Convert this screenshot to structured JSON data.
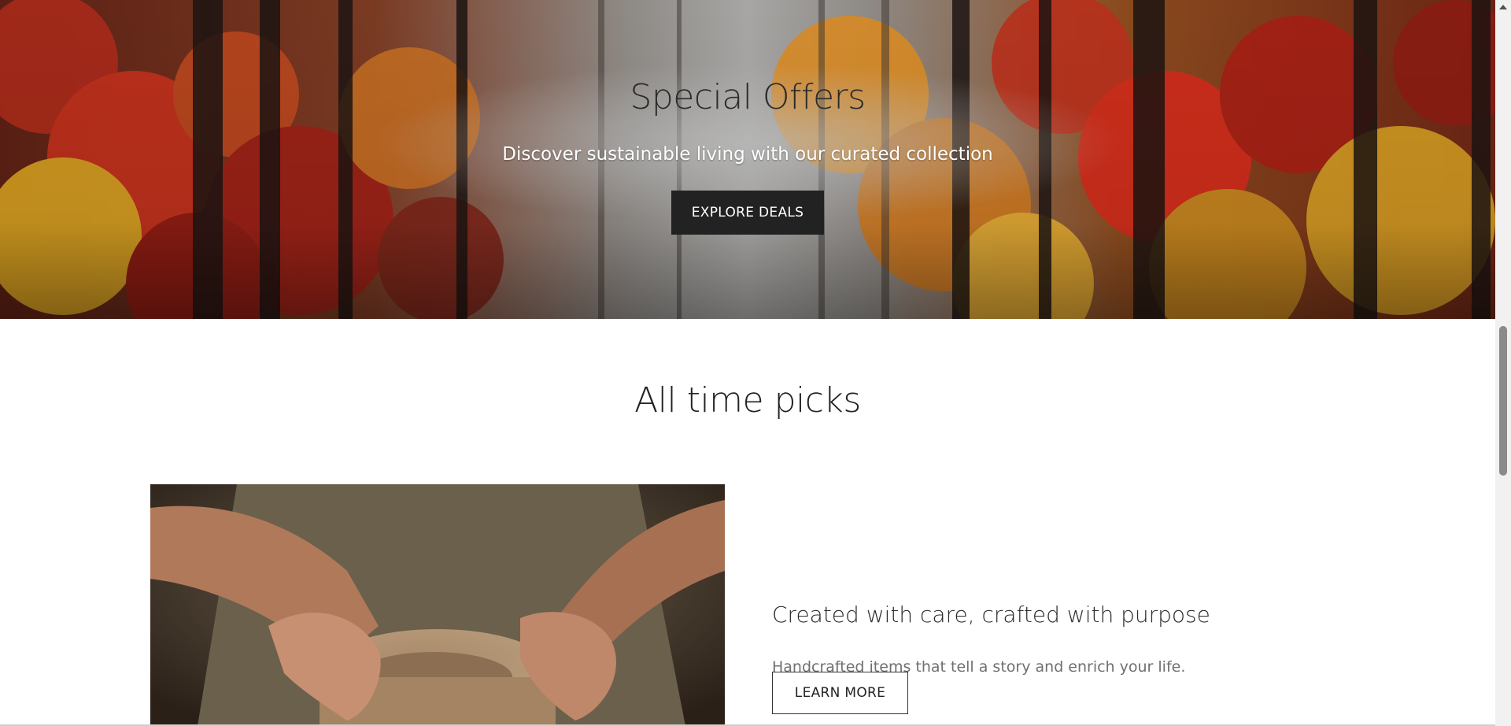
{
  "hero": {
    "title": "Special Offers",
    "subtitle": "Discover sustainable living with our curated collection",
    "button_label": "EXPLORE DEALS",
    "background": "autumn-forest-image"
  },
  "picks": {
    "section_title": "All time picks",
    "feature": {
      "image": "pottery-hands-image",
      "heading": "Created with care, crafted with purpose",
      "text": "Handcrafted items that tell a story and enrich your life.",
      "button_label": "LEARN MORE"
    }
  },
  "colors": {
    "button_dark": "#222222",
    "text_dark": "#2a2a2a",
    "text_muted": "#707070",
    "scroll_thumb": "#8a8a8a"
  }
}
